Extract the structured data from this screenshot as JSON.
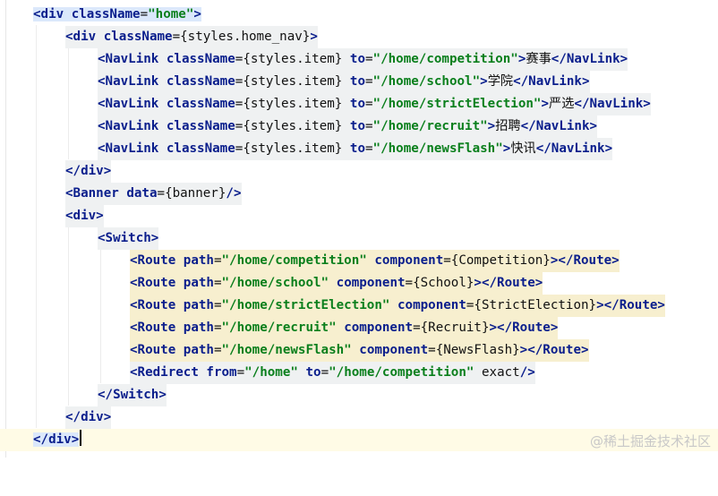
{
  "editor": {
    "lines": [
      {
        "text": "<div className=\"home\">"
      },
      {
        "text": "<div className={styles.home_nav}>"
      },
      {
        "text": "<NavLink className={styles.item} to=\"/home/competition\">赛事</NavLink>"
      },
      {
        "text": "<NavLink className={styles.item} to=\"/home/school\">学院</NavLink>"
      },
      {
        "text": "<NavLink className={styles.item} to=\"/home/strictElection\">严选</NavLink>"
      },
      {
        "text": "<NavLink className={styles.item} to=\"/home/recruit\">招聘</NavLink>"
      },
      {
        "text": "<NavLink className={styles.item} to=\"/home/newsFlash\">快讯</NavLink>"
      },
      {
        "text": "</div>"
      },
      {
        "text": "<Banner data={banner}/>"
      },
      {
        "text": "<div>"
      },
      {
        "text": "<Switch>"
      },
      {
        "text": "<Route path=\"/home/competition\" component={Competition}></Route>"
      },
      {
        "text": "<Route path=\"/home/school\" component={School}></Route>"
      },
      {
        "text": "<Route path=\"/home/strictElection\" component={StrictElection}></Route>"
      },
      {
        "text": "<Route path=\"/home/recruit\" component={Recruit}></Route>"
      },
      {
        "text": "<Route path=\"/home/newsFlash\" component={NewsFlash}></Route>"
      },
      {
        "text": "<Redirect from=\"/home\" to=\"/home/competition\" exact/>"
      },
      {
        "text": "</Switch>"
      },
      {
        "text": "</div>"
      },
      {
        "text": "</div>"
      }
    ]
  },
  "watermark": "@稀土掘金技术社区"
}
